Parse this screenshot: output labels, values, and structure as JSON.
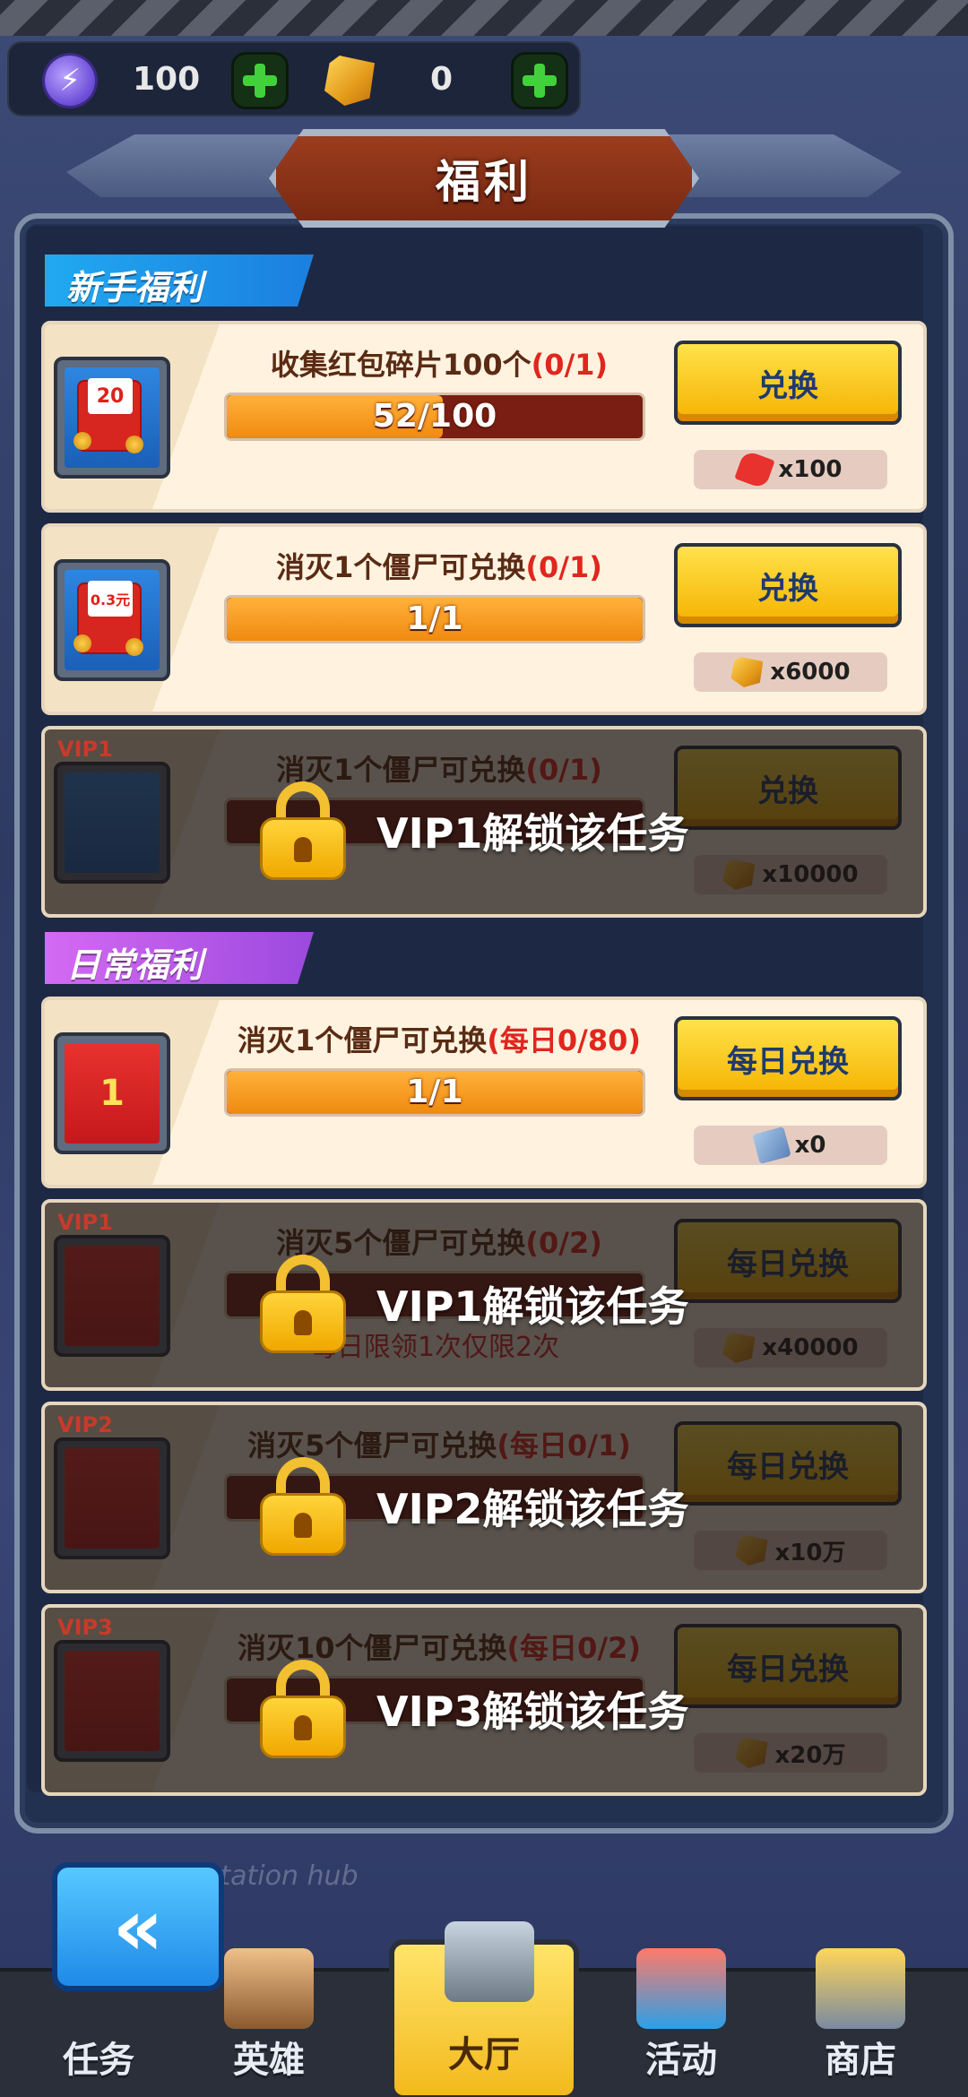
{
  "resources": {
    "energy_value": "100",
    "gem_value": "0"
  },
  "title": "福利",
  "sections": {
    "newbie": "新手福利",
    "daily": "日常福利"
  },
  "cards": [
    {
      "title": "收集红包碎片100个",
      "progress": "(0/1)",
      "bar_text": "52/100",
      "bar_fill": 0.52,
      "button": "兑换",
      "reward": "x100",
      "thumb_label": "20",
      "locked": false
    },
    {
      "title": "消灭1个僵尸可兑换",
      "progress": "(0/1)",
      "bar_text": "1/1",
      "bar_fill": 1.0,
      "button": "兑换",
      "reward": "x6000",
      "thumb_label": "0.3元",
      "locked": false
    },
    {
      "title": "消灭1个僵尸可兑换",
      "progress": "(0/1)",
      "button": "兑换",
      "reward": "x10000",
      "vip": "VIP1",
      "lock_text": "VIP1解锁该任务",
      "locked": true
    },
    {
      "title": "消灭1个僵尸可兑换",
      "progress": "(每日0/80)",
      "bar_text": "1/1",
      "bar_fill": 1.0,
      "button": "每日兑换",
      "reward": "x0",
      "thumb_label": "1",
      "locked": false
    },
    {
      "title": "消灭5个僵尸可兑换",
      "progress": "(0/2)",
      "button": "每日兑换",
      "reward": "x40000",
      "vip": "VIP1",
      "note": "每日限领1次仅限2次",
      "lock_text": "VIP1解锁该任务",
      "locked": true
    },
    {
      "title": "消灭5个僵尸可兑换",
      "progress": "(每日0/1)",
      "button": "每日兑换",
      "reward": "x10万",
      "vip": "VIP2",
      "lock_text": "VIP2解锁该任务",
      "locked": true
    },
    {
      "title": "消灭10个僵尸可兑换",
      "progress": "(每日0/2)",
      "button": "每日兑换",
      "reward": "x20万",
      "vip": "VIP3",
      "lock_text": "VIP3解锁该任务",
      "locked": true
    }
  ],
  "background_text": "sportation hub",
  "nav": {
    "tasks": "任务",
    "heroes": "英雄",
    "lobby": "大厅",
    "events": "活动",
    "shop": "商店"
  }
}
